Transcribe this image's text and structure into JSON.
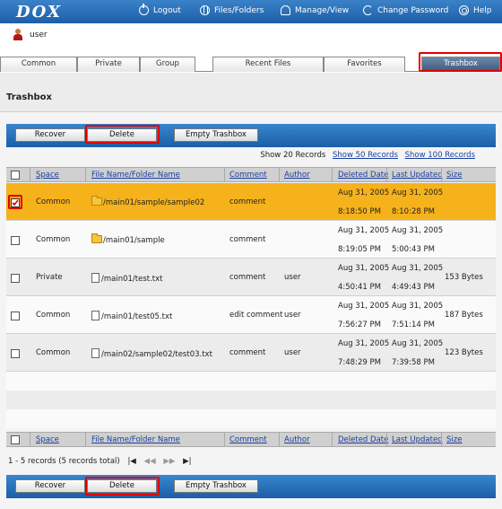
{
  "app": {
    "logo": "DOX"
  },
  "topnav": {
    "logout": "Logout",
    "files": "Files/Folders",
    "manage": "Manage/View",
    "password": "Change Password",
    "help": "Help"
  },
  "user": {
    "name": "user"
  },
  "tabs": [
    "Common",
    "Private",
    "Group",
    "Recent Files",
    "Favorites",
    "Trashbox"
  ],
  "page": {
    "title": "Trashbox"
  },
  "buttons": {
    "recover": "Recover",
    "delete": "Delete",
    "empty": "Empty Trashbox"
  },
  "show": {
    "current": "Show 20 Records",
    "opt50": "Show 50 Records",
    "opt100": "Show 100 Records"
  },
  "columns": [
    "Space",
    "File Name/Folder Name",
    "Comment",
    "Author",
    "Deleted Date",
    "Last Updated",
    "Size"
  ],
  "rows": [
    {
      "space": "Common",
      "name": "/main01/sample/sample02",
      "type": "folder",
      "comment": "comment",
      "author": "",
      "deleted_date": "Aug 31, 2005",
      "deleted_time": "8:18:50 PM",
      "updated_date": "Aug 31, 2005",
      "updated_time": "8:10:28 PM",
      "size": "",
      "checked": true
    },
    {
      "space": "Common",
      "name": "/main01/sample",
      "type": "folder",
      "comment": "comment",
      "author": "",
      "deleted_date": "Aug 31, 2005",
      "deleted_time": "8:19:05 PM",
      "updated_date": "Aug 31, 2005",
      "updated_time": "5:00:43 PM",
      "size": "",
      "checked": false
    },
    {
      "space": "Private",
      "name": "/main01/test.txt",
      "type": "file",
      "comment": "comment",
      "author": "user",
      "deleted_date": "Aug 31, 2005",
      "deleted_time": "4:50:41 PM",
      "updated_date": "Aug 31, 2005",
      "updated_time": "4:49:43 PM",
      "size": "153 Bytes",
      "checked": false
    },
    {
      "space": "Common",
      "name": "/main01/test05.txt",
      "type": "file",
      "comment": "edit comment",
      "author": "user",
      "deleted_date": "Aug 31, 2005",
      "deleted_time": "7:56:27 PM",
      "updated_date": "Aug 31, 2005",
      "updated_time": "7:51:14 PM",
      "size": "187 Bytes",
      "checked": false
    },
    {
      "space": "Common",
      "name": "/main02/sample02/test03.txt",
      "type": "file",
      "comment": "comment",
      "author": "user",
      "deleted_date": "Aug 31, 2005",
      "deleted_time": "7:48:29 PM",
      "updated_date": "Aug 31, 2005",
      "updated_time": "7:39:58 PM",
      "size": "123 Bytes",
      "checked": false
    }
  ],
  "pager": {
    "summary": "1 - 5 records (5 records total)",
    "first": "|◀",
    "prev": "◀◀",
    "next": "▶▶",
    "last": "▶|"
  }
}
